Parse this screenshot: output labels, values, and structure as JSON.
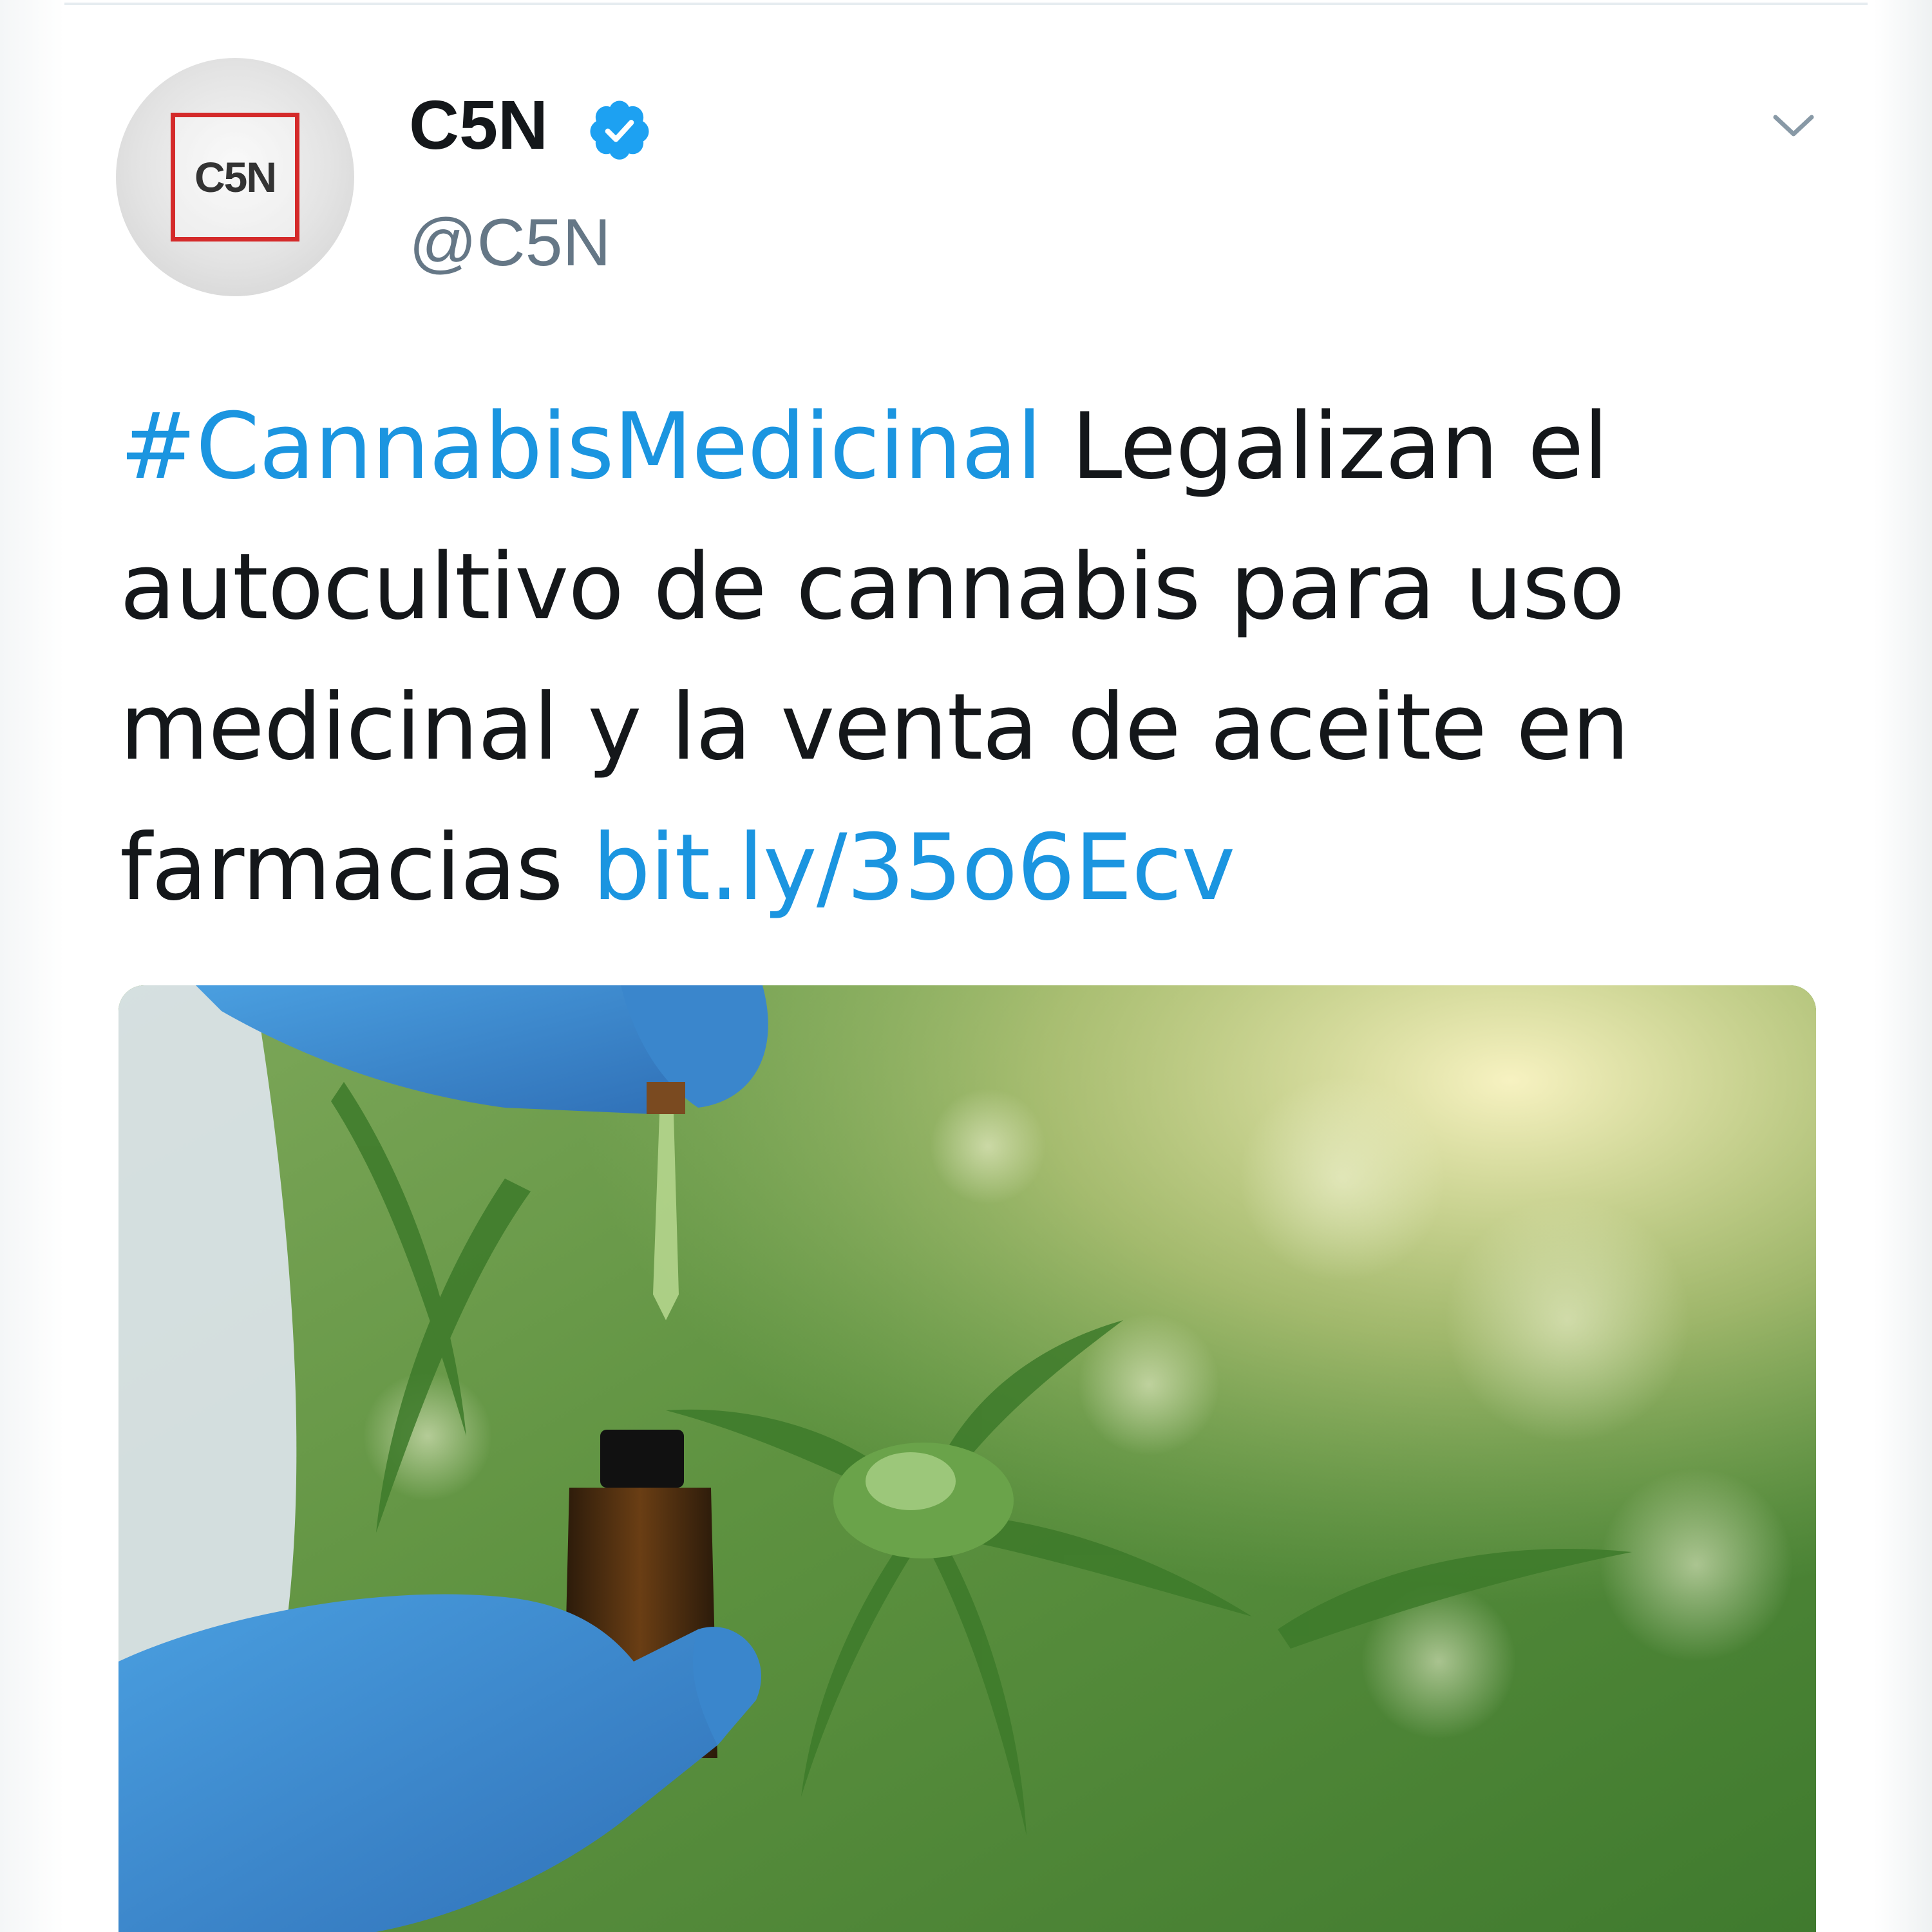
{
  "tweet": {
    "author": {
      "display_name": "C5N",
      "handle": "@C5N",
      "avatar_logo_text": "C5N",
      "verified": true
    },
    "text": {
      "hashtag": "#CannabisMedicinal",
      "body": " Legalizan el autocultivo de cannabis para uso medicinal y la venta de aceite en farmacias ",
      "link": "bit.ly/35o6Ecv"
    },
    "icons": {
      "verified": "verified-badge-icon",
      "menu": "chevron-down-icon"
    }
  },
  "colors": {
    "link_blue": "#1b95e0",
    "text": "#14171a",
    "secondary_text": "#657786",
    "verified_blue": "#1da1f2",
    "logo_red": "#d42a2a"
  }
}
